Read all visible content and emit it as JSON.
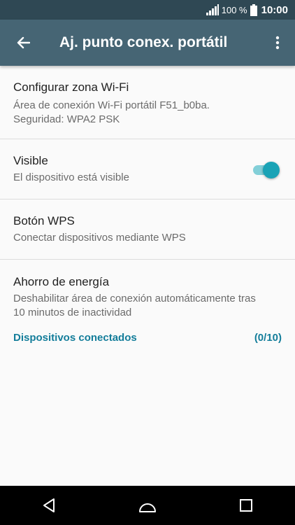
{
  "status_bar": {
    "battery_percent": "100 %",
    "time": "10:00"
  },
  "app_bar": {
    "title": "Aj. punto conex. portátil"
  },
  "settings": [
    {
      "title": "Configurar zona Wi-Fi",
      "summary_lines": [
        "Área de conexión Wi-Fi portátil F51_b0ba.",
        "Seguridad: WPA2 PSK"
      ]
    },
    {
      "title": "Visible",
      "summary_lines": [
        "El dispositivo está visible"
      ],
      "toggle_on": true
    },
    {
      "title": "Botón WPS",
      "summary_lines": [
        "Conectar dispositivos mediante WPS"
      ]
    },
    {
      "title": "Ahorro de energía",
      "summary_lines": [
        "Deshabilitar área de conexión automáticamente tras",
        "10 minutos de inactividad"
      ]
    }
  ],
  "connected_devices": {
    "label": "Dispositivos conectados",
    "count": "(0/10)"
  },
  "colors": {
    "status_bar": "#2f4854",
    "app_bar": "#466574",
    "accent": "#137d9a",
    "toggle_thumb": "#1aa3b6"
  },
  "icons": [
    "signal-icon",
    "battery-icon",
    "back-arrow-icon",
    "more-vert-icon",
    "nav-back-icon",
    "nav-home-icon",
    "nav-recents-icon"
  ]
}
